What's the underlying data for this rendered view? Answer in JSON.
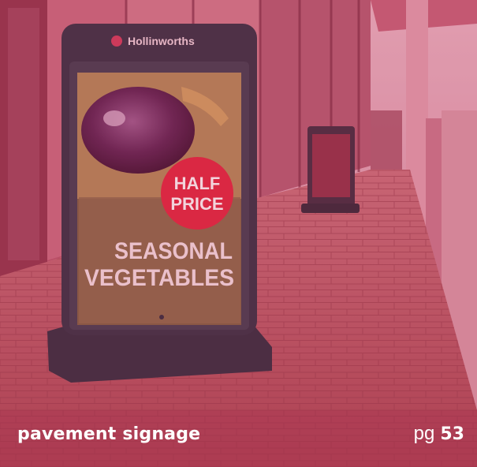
{
  "sign": {
    "brand": "Hollinworths",
    "badge_line1": "HALF",
    "badge_line2": "PRICE",
    "headline_line1": "SEASONAL",
    "headline_line2": "VEGETABLES"
  },
  "caption": {
    "title": "pavement signage",
    "page_prefix": "pg",
    "page_number": "53"
  },
  "colors": {
    "tint": "#c23a5e",
    "badge": "#e0233c",
    "sign_frame": "#2b2b3c",
    "pavement": "#b8545c"
  }
}
